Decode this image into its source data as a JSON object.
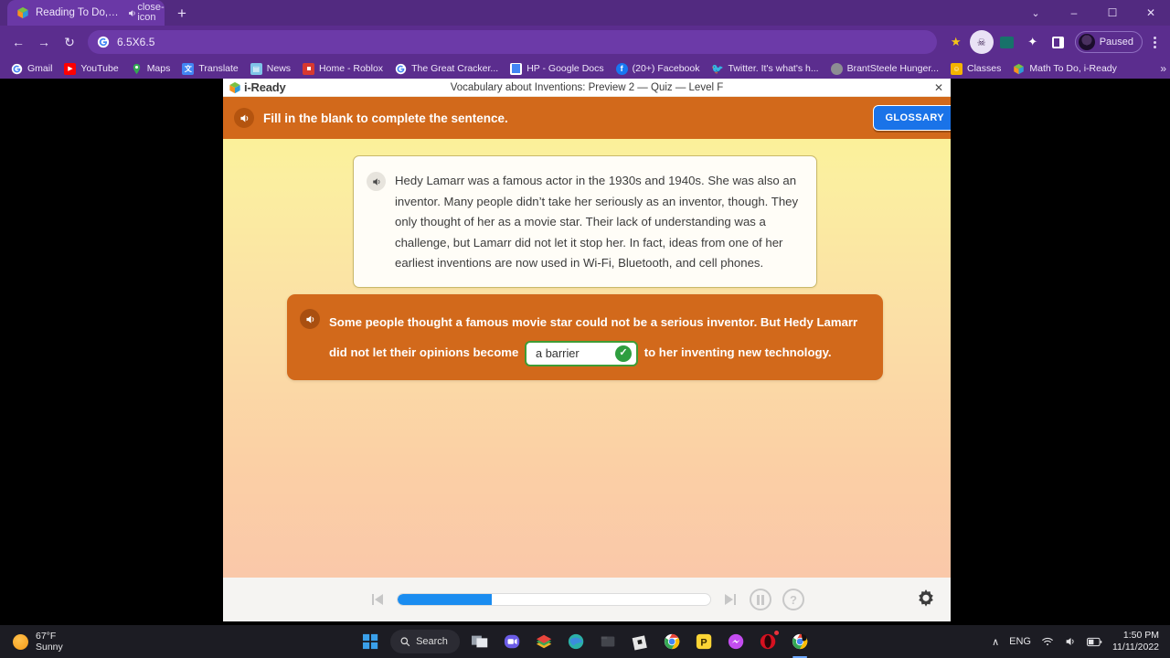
{
  "browser": {
    "tab": {
      "title": "Reading To Do, i-Ready",
      "favicon_name": "i-ready-favicon",
      "audio_icon": "speaker-icon",
      "close_icon": "close-icon"
    },
    "new_tab_label": "+",
    "window_controls": {
      "tab_search": "⌄",
      "minimize": "–",
      "maximize": "☐",
      "close": "✕"
    },
    "nav": {
      "back": "←",
      "forward": "→",
      "reload": "↻"
    },
    "omnibox": {
      "value": "6.5X6.5",
      "search_engine_icon": "google-icon"
    },
    "toolbar_icons": [
      {
        "name": "bookmark-star-icon",
        "glyph": "★",
        "color": "#f5c518"
      },
      {
        "name": "extension-skull-icon",
        "glyph": "☠",
        "color": "#e8e2f2"
      },
      {
        "name": "extension-teal-icon",
        "glyph": "◢",
        "color": "#1f7a6e"
      },
      {
        "name": "extensions-puzzle-icon",
        "glyph": "✦",
        "color": "#ffffff"
      },
      {
        "name": "side-panel-icon",
        "glyph": "▣",
        "color": "#ffffff"
      }
    ],
    "profile": {
      "label": "Paused",
      "avatar_name": "profile-avatar"
    },
    "menu_icon": "kebab-menu-icon",
    "bookmarks": [
      {
        "label": "Gmail",
        "icon": "gmail-icon",
        "color": "#ffffff"
      },
      {
        "label": "YouTube",
        "icon": "youtube-icon",
        "color": "#ff0000"
      },
      {
        "label": "Maps",
        "icon": "maps-icon",
        "color": "#34a853"
      },
      {
        "label": "Translate",
        "icon": "translate-icon",
        "color": "#4285f4"
      },
      {
        "label": "News",
        "icon": "news-icon",
        "color": "#5ab9e8"
      },
      {
        "label": "Home - Roblox",
        "icon": "roblox-icon",
        "color": "#e03a3e"
      },
      {
        "label": "The Great Cracker...",
        "icon": "google-icon",
        "color": "#ffffff"
      },
      {
        "label": "HP - Google Docs",
        "icon": "google-docs-icon",
        "color": "#4285f4"
      },
      {
        "label": "(20+) Facebook",
        "icon": "facebook-icon",
        "color": "#1877f2"
      },
      {
        "label": "Twitter. It's what's h...",
        "icon": "twitter-icon",
        "color": "#1d9bf0"
      },
      {
        "label": "BrantSteele Hunger...",
        "icon": "brantsteele-icon",
        "color": "#8a8a8a"
      },
      {
        "label": "Classes",
        "icon": "classes-icon",
        "color": "#f5b400"
      },
      {
        "label": "Math To Do, i-Ready",
        "icon": "i-ready-favicon",
        "color": "#7ac143"
      }
    ],
    "bookmarks_overflow": "»"
  },
  "app": {
    "brand": "i-Ready",
    "title": "Vocabulary about Inventions: Preview 2 — Quiz — Level F",
    "close_label": "✕",
    "instruction": "Fill in the blank to complete the sentence.",
    "glossary_label": "GLOSSARY",
    "passage": {
      "speaker_icon": "speaker-icon",
      "text": "Hedy Lamarr was a famous actor in the 1930s and 1940s. She was also an inventor. Many people didn’t take her seriously as an inventor, though. They only thought of her as a movie star. Their lack of understanding was a challenge, but Lamarr did not let it stop her. In fact, ideas from one of her earliest inventions are now used in Wi-Fi, Bluetooth, and cell phones."
    },
    "question": {
      "speaker_icon": "speaker-icon",
      "part1": "Some people thought a famous movie star could not be a serious inventor. But Hedy Lamarr did not let their opinions become",
      "answer_value": "a barrier",
      "answer_status": "correct",
      "check_glyph": "✓",
      "part2": "to her inventing new technology."
    },
    "footer": {
      "prev_label": "previous",
      "next_label": "next",
      "pause_label": "pause",
      "help_label": "?",
      "settings_label": "settings",
      "progress_percent": 30
    }
  },
  "taskbar": {
    "weather": {
      "temp": "67°F",
      "condition": "Sunny"
    },
    "start_label": "start",
    "search_label": "Search",
    "apps": [
      {
        "name": "task-view-icon",
        "badge": false
      },
      {
        "name": "zoom-icon",
        "badge": false
      },
      {
        "name": "books-icon",
        "badge": false
      },
      {
        "name": "edge-icon",
        "badge": false
      },
      {
        "name": "file-explorer-icon",
        "badge": false
      },
      {
        "name": "roblox-icon",
        "badge": false
      },
      {
        "name": "chrome-icon",
        "badge": false
      },
      {
        "name": "paint-icon",
        "badge": false
      },
      {
        "name": "messenger-icon",
        "badge": false
      },
      {
        "name": "opera-icon",
        "badge": true
      },
      {
        "name": "chrome-active-icon",
        "badge": false
      }
    ],
    "tray": {
      "overflow": "∧",
      "language": "ENG",
      "wifi_icon": "wifi-icon",
      "volume_icon": "volume-icon",
      "battery_icon": "battery-icon",
      "time": "1:50 PM",
      "date": "11/11/2022"
    }
  }
}
